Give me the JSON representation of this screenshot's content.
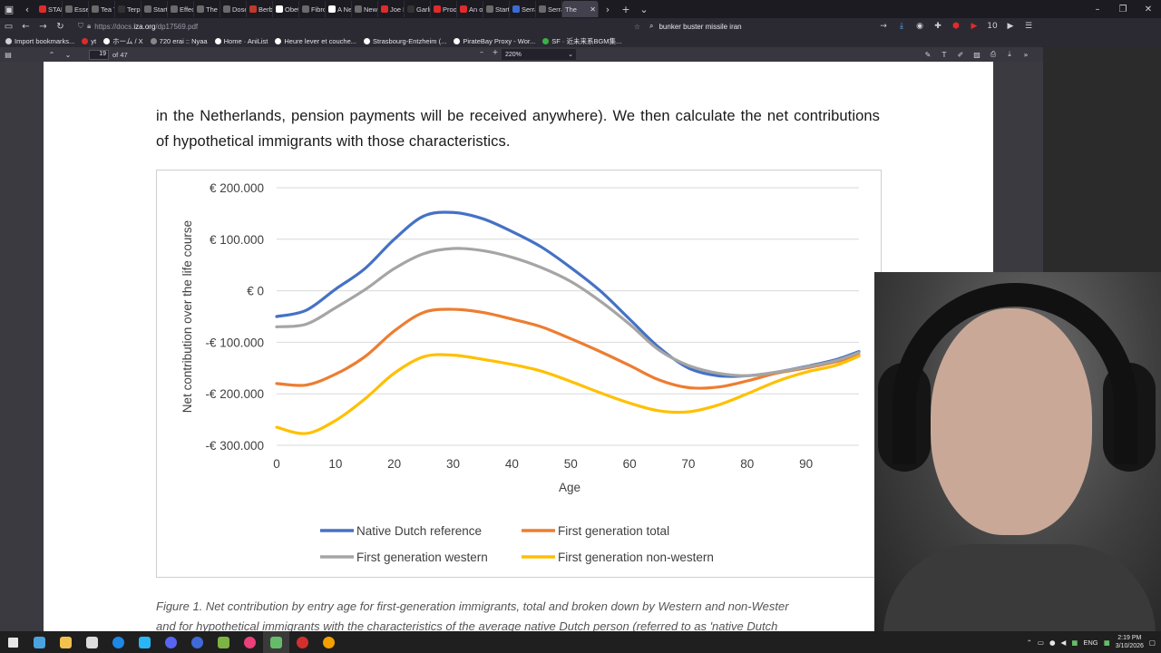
{
  "tabs": [
    {
      "label": "STALK",
      "color": "#e02b2b"
    },
    {
      "label": "Essent",
      "color": "#6a6a6a"
    },
    {
      "label": "Tea Tr",
      "color": "#6a6a6a"
    },
    {
      "label": "Terpir",
      "color": "#333333"
    },
    {
      "label": "Startp",
      "color": "#6a6a6a"
    },
    {
      "label": "Effect",
      "color": "#6a6a6a"
    },
    {
      "label": "The Fi",
      "color": "#6a6a6a"
    },
    {
      "label": "Dose",
      "color": "#6a6a6a"
    },
    {
      "label": "Berbe",
      "color": "#c0392b"
    },
    {
      "label": "Obeti",
      "color": "#ffffff"
    },
    {
      "label": "Fibrol",
      "color": "#6a6a6a"
    },
    {
      "label": "A New",
      "color": "#ffffff"
    },
    {
      "label": "New t",
      "color": "#6a6a6a"
    },
    {
      "label": "Joe M",
      "color": "#e02b2b"
    },
    {
      "label": "Garlic",
      "color": "#333333"
    },
    {
      "label": "Proof Th",
      "color": "#e02b2b"
    },
    {
      "label": "An ol",
      "color": "#e02b2b"
    },
    {
      "label": "Startp",
      "color": "#6a6a6a"
    },
    {
      "label": "Serraj",
      "color": "#3b6bd6"
    },
    {
      "label": "Serrat",
      "color": "#6a6a6a"
    }
  ],
  "active_tab": {
    "label": "The"
  },
  "nav": {
    "url_prefix": "https://docs.",
    "url_domain": "iza.org",
    "url_path": "/dp17569.pdf",
    "search_value": "bunker buster missile iran"
  },
  "bookmarks": [
    {
      "label": "Import bookmarks...",
      "color": "#cfcfd8"
    },
    {
      "label": "yt",
      "color": "#e02b2b"
    },
    {
      "label": "ホーム / X",
      "color": "#ffffff"
    },
    {
      "label": "720 erai :: Nyaa",
      "color": "#888888"
    },
    {
      "label": "Home · AniList",
      "color": "#ffffff"
    },
    {
      "label": "Heure lever et couche...",
      "color": "#ffffff"
    },
    {
      "label": "Strasbourg-Entzheim (...",
      "color": "#ffffff"
    },
    {
      "label": "PirateBay Proxy - Wor...",
      "color": "#ffffff"
    },
    {
      "label": "SF · 近未来系BGM集...",
      "color": "#3cb043"
    }
  ],
  "pdf": {
    "page_number": "19",
    "page_count": "of 47",
    "zoom": "220%",
    "body_text": "in the Netherlands, pension payments will be received anywhere). We then calculate the net contributions of hypothetical immigrants with those characteristics.",
    "caption_line1": "Figure 1. Net contribution by entry age for first-generation immigrants, total and broken down by Western and non-Wester",
    "caption_line2": "and for hypothetical immigrants with the characteristics of the average native Dutch person (referred to as 'native Dutch"
  },
  "chart_data": {
    "type": "line",
    "xlabel": "Age",
    "ylabel": "Net contribution over the life course",
    "xlim": [
      0,
      99
    ],
    "ylim": [
      -300000,
      200000
    ],
    "x_ticks": [
      "0",
      "10",
      "20",
      "30",
      "40",
      "50",
      "60",
      "70",
      "80",
      "90"
    ],
    "y_ticks": [
      "€ 200.000",
      "€ 100.000",
      "€ 0",
      "-€ 100.000",
      "-€ 200.000",
      "-€ 300.000"
    ],
    "grid": "horizontal",
    "legend_position": "bottom",
    "series": [
      {
        "name": "Native Dutch reference",
        "color": "#4472c4",
        "x": [
          0,
          5,
          10,
          15,
          20,
          25,
          30,
          35,
          40,
          45,
          50,
          55,
          60,
          65,
          70,
          75,
          80,
          85,
          90,
          95,
          99
        ],
        "values": [
          -50000,
          -38000,
          3000,
          43000,
          100000,
          145000,
          152000,
          140000,
          115000,
          85000,
          45000,
          0,
          -55000,
          -110000,
          -150000,
          -165000,
          -165000,
          -158000,
          -147000,
          -134000,
          -118000
        ]
      },
      {
        "name": "First generation total",
        "color": "#ed7d31",
        "x": [
          0,
          5,
          10,
          15,
          20,
          25,
          30,
          35,
          40,
          45,
          50,
          55,
          60,
          65,
          70,
          75,
          80,
          85,
          90,
          95,
          99
        ],
        "values": [
          -180000,
          -183000,
          -162000,
          -128000,
          -78000,
          -42000,
          -36000,
          -42000,
          -55000,
          -70000,
          -93000,
          -118000,
          -145000,
          -173000,
          -188000,
          -187000,
          -175000,
          -160000,
          -150000,
          -138000,
          -125000
        ]
      },
      {
        "name": "First generation western",
        "color": "#a5a5a5",
        "x": [
          0,
          5,
          10,
          15,
          20,
          25,
          30,
          35,
          40,
          45,
          50,
          55,
          60,
          65,
          70,
          75,
          80,
          85,
          90,
          95,
          99
        ],
        "values": [
          -70000,
          -65000,
          -33000,
          2000,
          43000,
          72000,
          82000,
          78000,
          65000,
          45000,
          18000,
          -20000,
          -65000,
          -115000,
          -145000,
          -160000,
          -165000,
          -158000,
          -148000,
          -136000,
          -120000
        ]
      },
      {
        "name": "First generation non-western",
        "color": "#ffc000",
        "x": [
          0,
          5,
          10,
          15,
          20,
          25,
          30,
          35,
          40,
          45,
          50,
          55,
          60,
          65,
          70,
          75,
          80,
          85,
          90,
          95,
          99
        ],
        "values": [
          -265000,
          -277000,
          -252000,
          -210000,
          -160000,
          -128000,
          -125000,
          -133000,
          -143000,
          -156000,
          -176000,
          -198000,
          -218000,
          -233000,
          -235000,
          -222000,
          -200000,
          -176000,
          -158000,
          -145000,
          -127000
        ]
      }
    ]
  },
  "taskbar": {
    "language": "ENG",
    "time": "2:19 PM",
    "date": "3/10/2026"
  }
}
